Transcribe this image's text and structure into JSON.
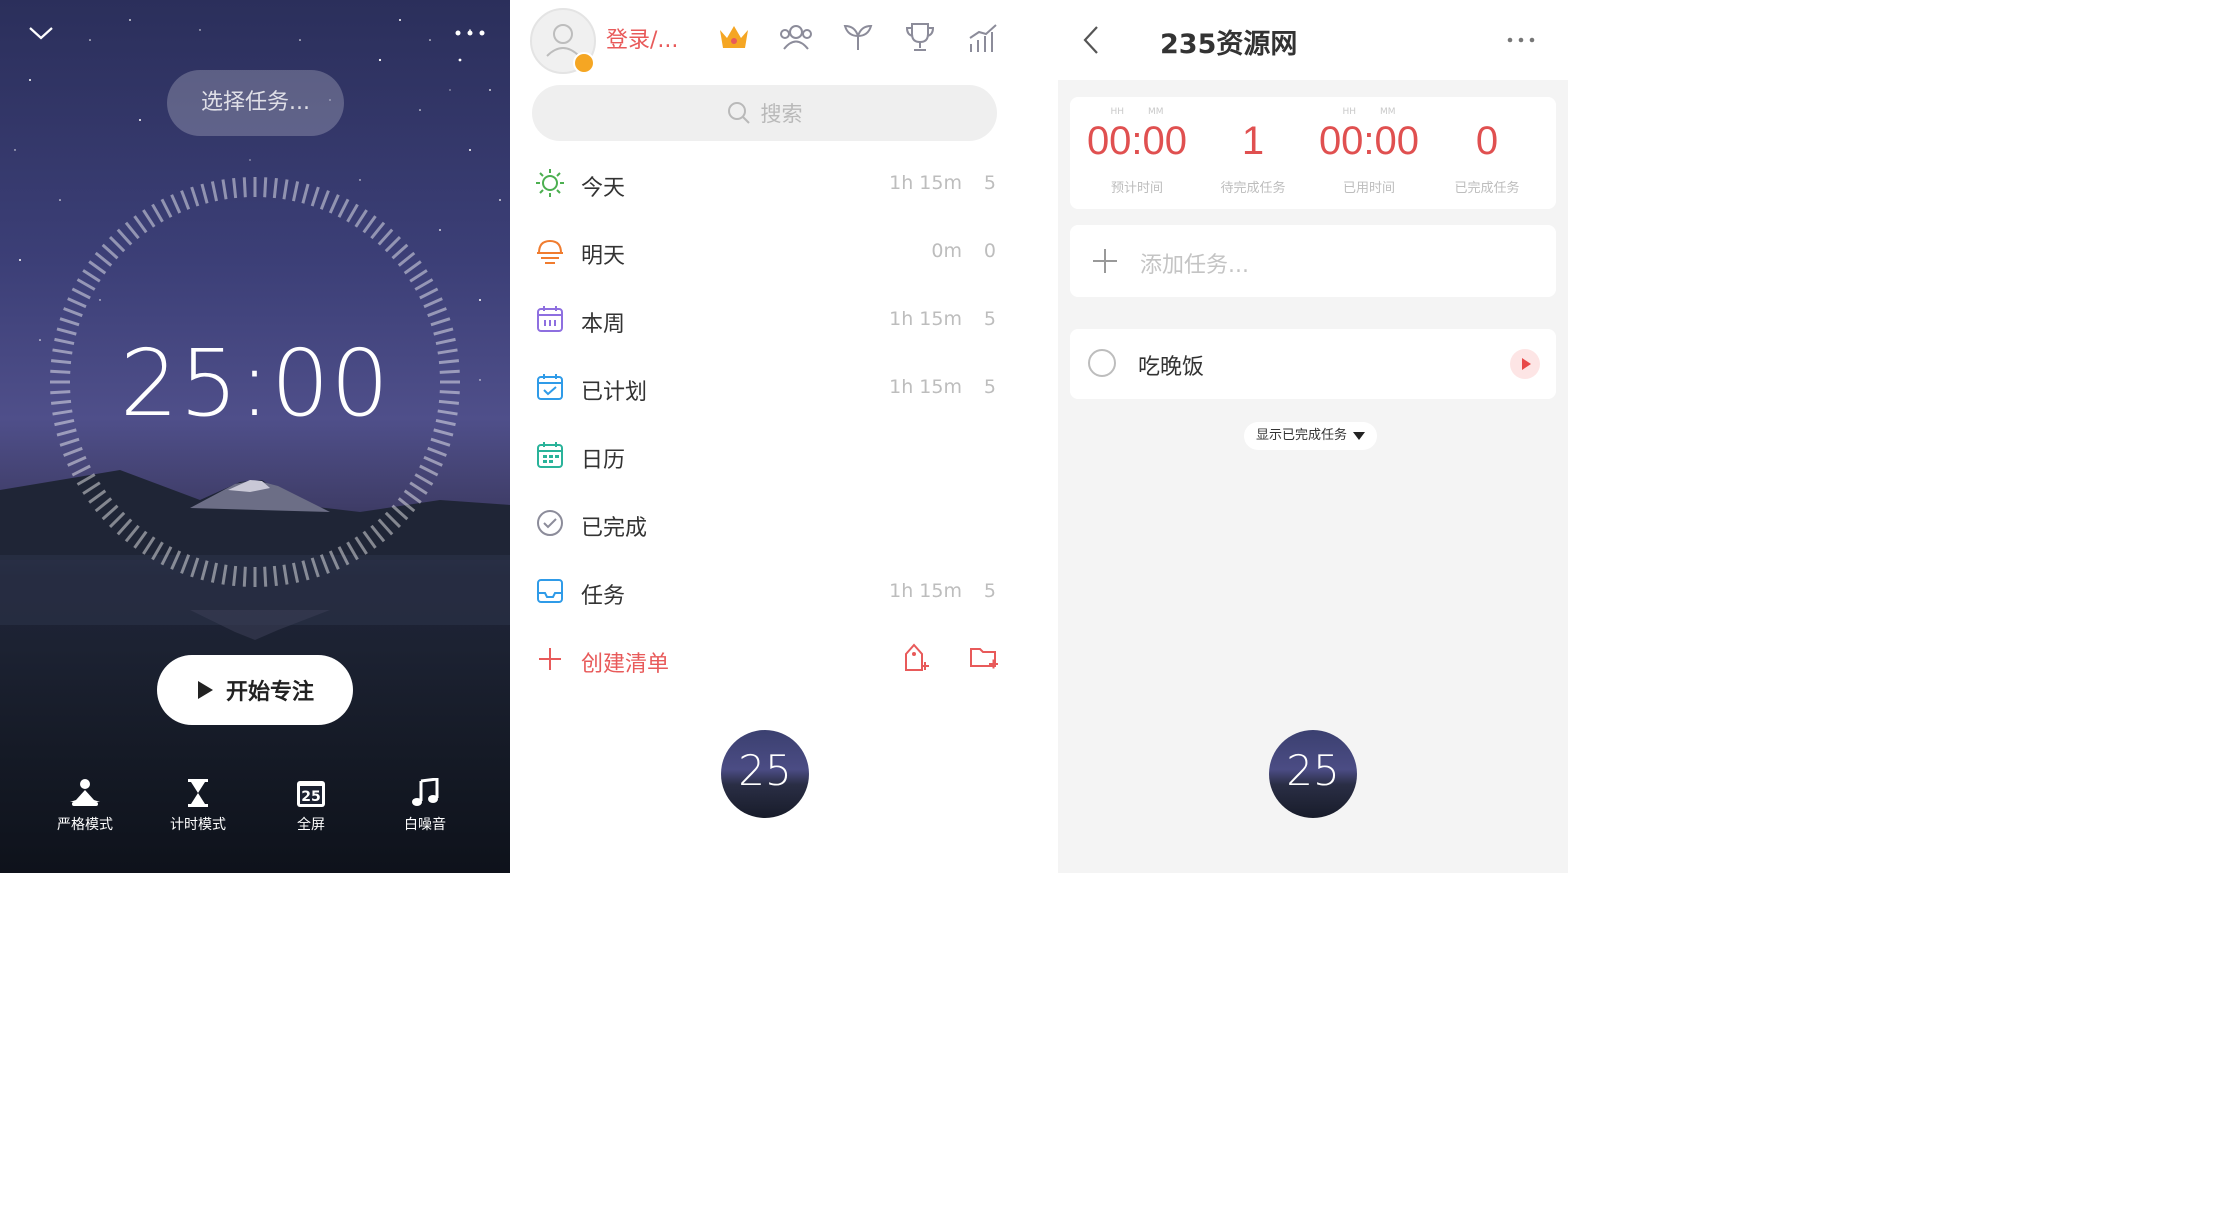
{
  "left": {
    "task_selector": "选择任务...",
    "timer": "25:00",
    "start_button": "开始专注",
    "modes": [
      {
        "label": "严格模式",
        "icon": "meditation-icon"
      },
      {
        "label": "计时模式",
        "icon": "hourglass-icon"
      },
      {
        "label": "全屏",
        "icon": "fullscreen-25-icon",
        "badge": "25"
      },
      {
        "label": "白噪音",
        "icon": "music-note-icon"
      }
    ]
  },
  "middle": {
    "login": "登录/...",
    "search_placeholder": "搜索",
    "menu": [
      {
        "label": "今天",
        "time": "1h 15m",
        "count": "5",
        "icon": "sun-icon",
        "color": "#4caf50"
      },
      {
        "label": "明天",
        "time": "0m",
        "count": "0",
        "icon": "sunset-icon",
        "color": "#f07c2f"
      },
      {
        "label": "本周",
        "time": "1h 15m",
        "count": "5",
        "icon": "calendar-week-icon",
        "color": "#8e6fe0"
      },
      {
        "label": "已计划",
        "time": "1h 15m",
        "count": "5",
        "icon": "calendar-check-icon",
        "color": "#2f9be8"
      },
      {
        "label": "日历",
        "time": "",
        "count": "",
        "icon": "calendar-grid-icon",
        "color": "#2ab39a"
      },
      {
        "label": "已完成",
        "time": "",
        "count": "",
        "icon": "check-circle-icon",
        "color": "#8c8c9a"
      },
      {
        "label": "任务",
        "time": "1h 15m",
        "count": "5",
        "icon": "inbox-icon",
        "color": "#2f9be8"
      }
    ],
    "create_list": "创建清单",
    "mini_timer": "25"
  },
  "right": {
    "title": "235资源网",
    "stats": [
      {
        "value": "00:00",
        "label": "预计时间",
        "units": [
          "HH",
          "MM"
        ]
      },
      {
        "value": "1",
        "label": "待完成任务",
        "units": []
      },
      {
        "value": "00:00",
        "label": "已用时间",
        "units": [
          "HH",
          "MM"
        ]
      },
      {
        "value": "0",
        "label": "已完成任务",
        "units": []
      }
    ],
    "add_task_placeholder": "添加任务...",
    "tasks": [
      {
        "name": "吃晚饭"
      }
    ],
    "show_completed": "显示已完成任务",
    "mini_timer": "25"
  },
  "colors": {
    "accent": "#e85a5a",
    "gold": "#f5a623",
    "muted": "#bdbdbd"
  }
}
